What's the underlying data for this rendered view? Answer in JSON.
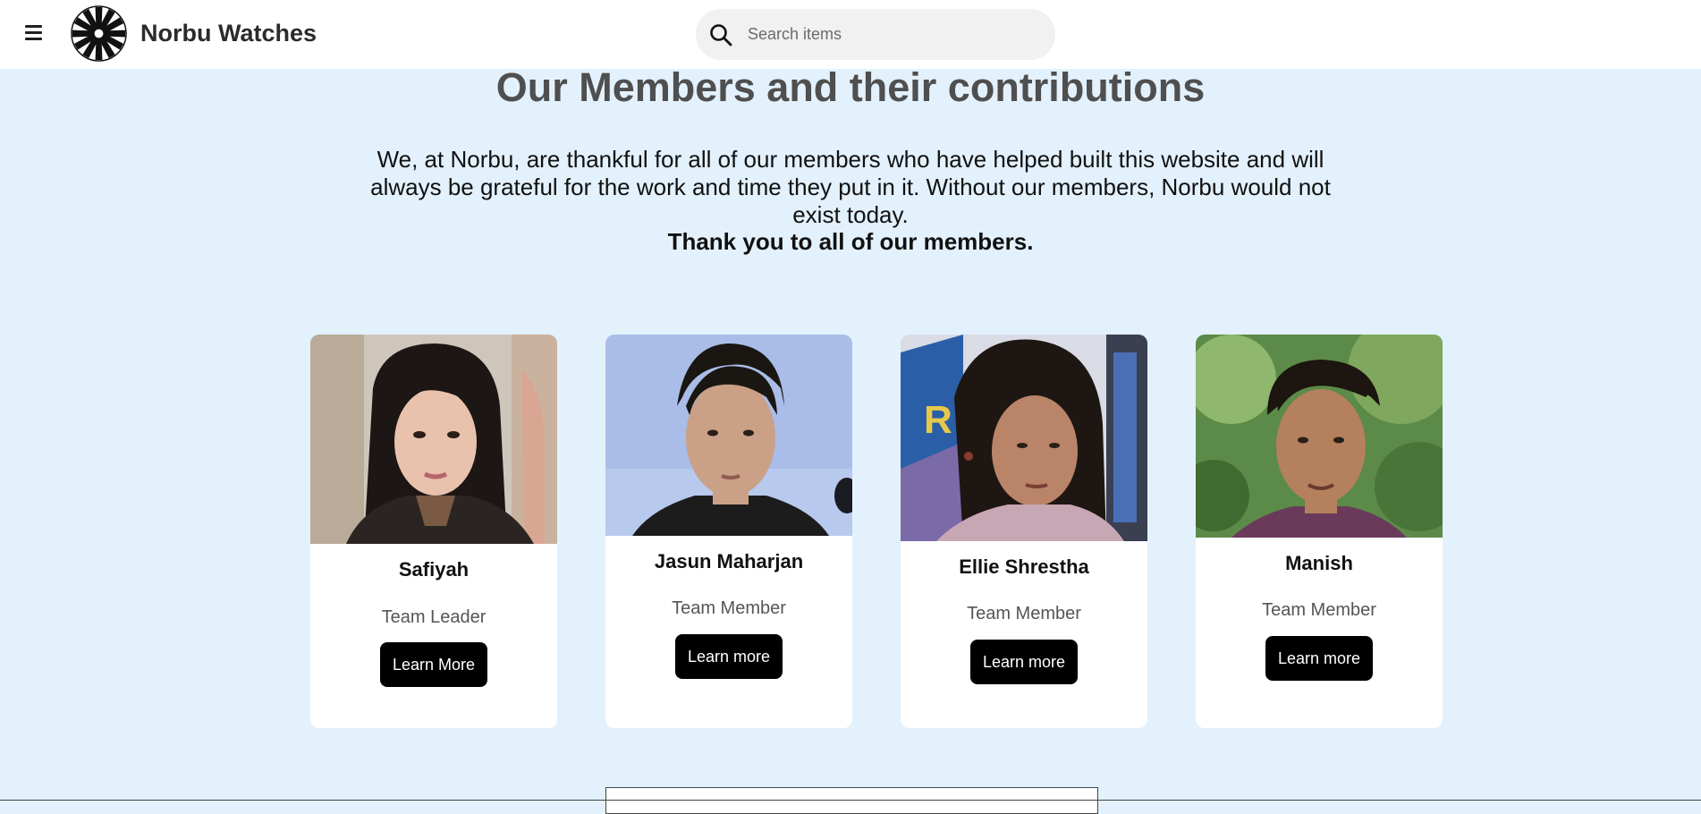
{
  "header": {
    "brand": "Norbu Watches",
    "menu_icon": "hamburger-menu-icon",
    "logo_icon": "starburst-logo-icon",
    "search": {
      "placeholder": "Search items",
      "value": "",
      "icon": "search-icon"
    }
  },
  "main": {
    "title": "Our Members and their contributions",
    "intro": "We, at Norbu, are thankful for all of our members who have helped built this website and will always be grateful for the work and time they put in it. Without our members, Norbu would not exist today.",
    "thanks": "Thank you to all of our members."
  },
  "members": [
    {
      "name": "Safiyah",
      "role": "Team Leader",
      "button": "Learn More"
    },
    {
      "name": "Jasun Maharjan",
      "role": "Team Member",
      "button": "Learn more"
    },
    {
      "name": "Ellie Shrestha",
      "role": "Team Member",
      "button": "Learn more"
    },
    {
      "name": "Manish",
      "role": "Team Member",
      "button": "Learn more"
    }
  ],
  "colors": {
    "page_background": "#e3f1fc",
    "header_background": "#ffffff",
    "button_background": "#000000",
    "button_text": "#ffffff",
    "title_text": "#4f4f4f"
  }
}
